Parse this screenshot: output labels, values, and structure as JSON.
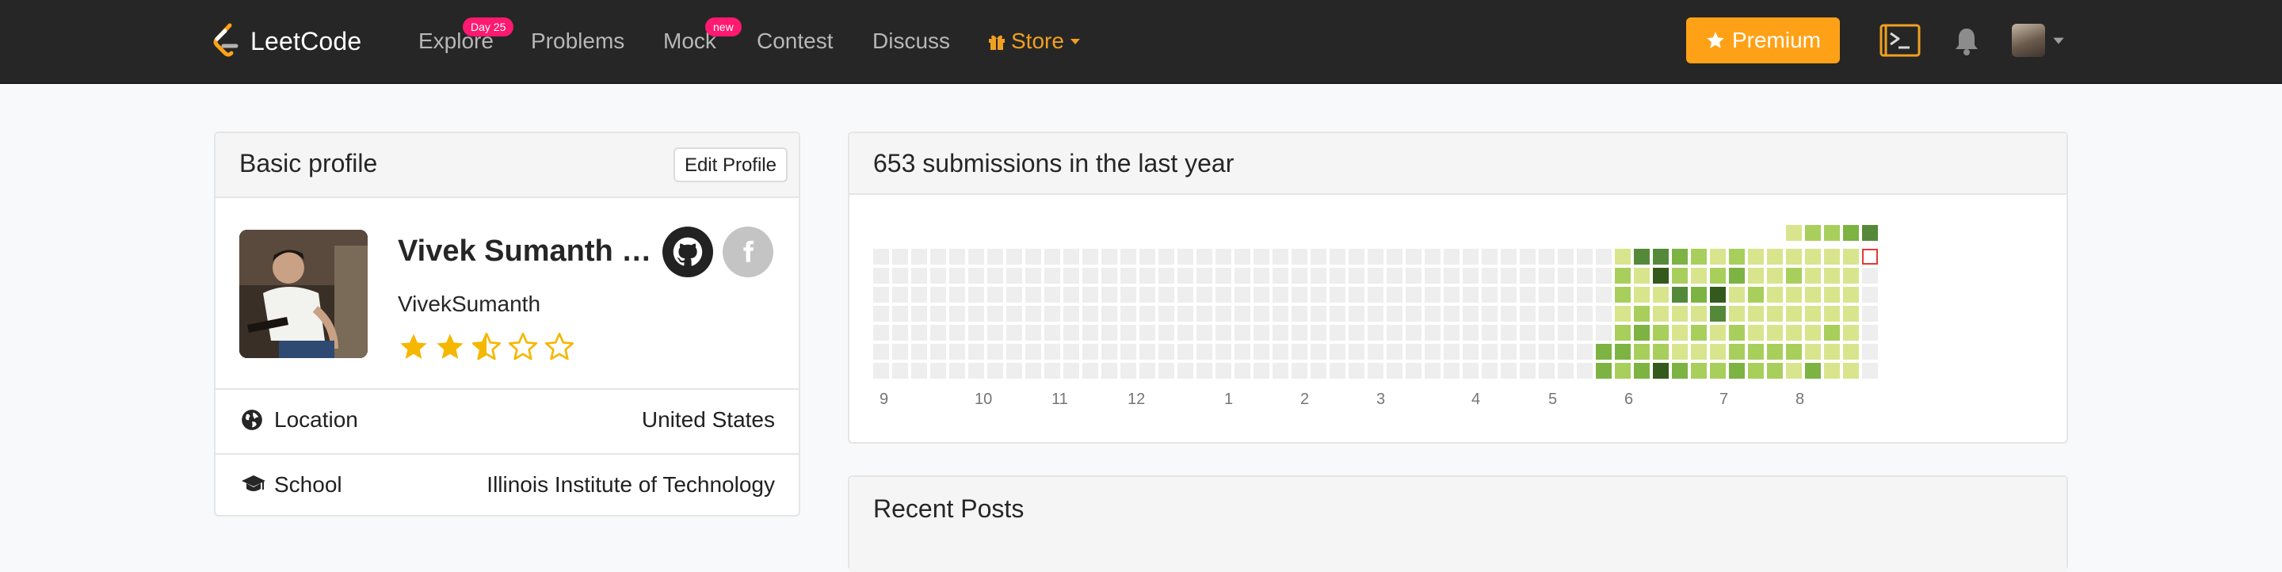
{
  "navbar": {
    "logo_text": "LeetCode",
    "items": [
      {
        "label": "Explore",
        "badge": "Day 25"
      },
      {
        "label": "Problems"
      },
      {
        "label": "Mock",
        "badge": "new"
      },
      {
        "label": "Contest"
      },
      {
        "label": "Discuss"
      }
    ],
    "store_label": "Store",
    "premium_label": "Premium",
    "icons": [
      "gift-icon",
      "caret-down-icon",
      "star-icon",
      "terminal-icon",
      "bell-icon",
      "avatar",
      "caret-down-icon"
    ]
  },
  "profile": {
    "card_title": "Basic profile",
    "edit_label": "Edit Profile",
    "real_name": "Vivek Sumanth C...",
    "username": "VivekSumanth",
    "rating_stars": 2.5,
    "rating_max": 5,
    "location_label": "Location",
    "location_value": "United States",
    "school_label": "School",
    "school_value": "Illinois Institute of Technology",
    "social": [
      "github-icon",
      "facebook-icon"
    ]
  },
  "submissions": {
    "title": "653 submissions in the last year",
    "months": [
      "9",
      "10",
      "11",
      "12",
      "1",
      "2",
      "3",
      "4",
      "5",
      "6",
      "7",
      "8"
    ],
    "colors": {
      "empty": "#eeeeee",
      "level1": "#d8e58d",
      "level2": "#a8cf5c",
      "level3": "#7cb342",
      "level4": "#55893a",
      "level5": "#33591c",
      "today_outline": "#e53935"
    }
  },
  "recent_posts": {
    "title": "Recent Posts"
  }
}
